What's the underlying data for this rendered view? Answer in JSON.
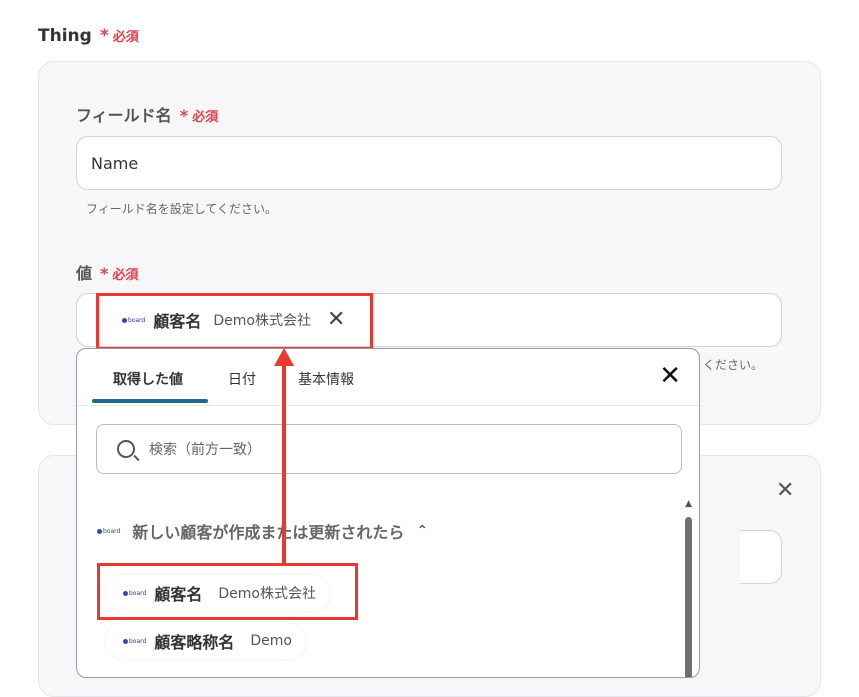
{
  "section": {
    "label": "Thing",
    "required": "必須",
    "star": "*"
  },
  "field_name": {
    "label": "フィールド名",
    "required": "必須",
    "value": "Name",
    "hint": "フィールド名を設定してください。"
  },
  "value_field": {
    "label": "値",
    "required": "必須",
    "chip": {
      "logo": "board",
      "key": "顧客名",
      "value": "Demo株式会社",
      "close": "✕"
    },
    "hint_tail": "ください。"
  },
  "dropdown": {
    "tabs": [
      "取得した値",
      "日付",
      "基本情報"
    ],
    "close": "✕",
    "search_placeholder": "検索（前方一致）",
    "group": {
      "logo": "board",
      "title": "新しい顧客が作成または更新されたら",
      "chevron": "⌃"
    },
    "items": [
      {
        "logo": "board",
        "key": "顧客名",
        "value": "Demo株式会社"
      },
      {
        "logo": "board",
        "key": "顧客略称名",
        "value": "Demo"
      }
    ]
  },
  "card2": {
    "close": "✕"
  },
  "colors": {
    "accent": "#1d6a8a",
    "required": "#e0434b",
    "highlight": "#e8392f"
  }
}
